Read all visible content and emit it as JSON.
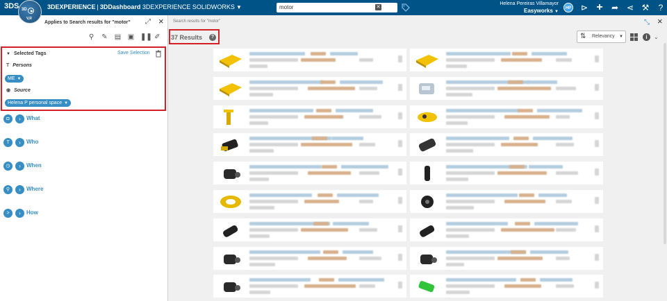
{
  "topbar": {
    "logo_text": "3DS",
    "compass_top": "3D",
    "compass_bottom": "V,R",
    "brand": "3DEXPERIENCE",
    "separator": "|",
    "app": "3DDashboard",
    "context": "3DEXPERIENCE SOLIDWORKS",
    "search_value": "motor",
    "user_name": "Helena Pereiras Villamayor",
    "user_role": "Easyworks",
    "avatar_initials": "HP"
  },
  "left_panel": {
    "title": "Applies to Search results for \"motor\"",
    "selected_tags_label": "Selected Tags",
    "save_selection_label": "Save Selection",
    "persons_label": "Persons",
    "persons_tag": "ME",
    "source_label": "Source",
    "source_tag": "Helena P personal space",
    "categories": [
      "What",
      "Who",
      "When",
      "Where",
      "How"
    ]
  },
  "right_panel": {
    "header": "Search results for \"motor\"",
    "results_count": "37 Results",
    "sort_label": "Relevancy"
  },
  "colors": {
    "topbar": "#005386",
    "accent": "#368ec4",
    "highlight_border": "#d32027"
  },
  "results": [
    {
      "thumb": "yellow-plate"
    },
    {
      "thumb": "yellow-plate"
    },
    {
      "thumb": "yellow-plate"
    },
    {
      "thumb": "grey-block"
    },
    {
      "thumb": "yellow-bracket"
    },
    {
      "thumb": "yellow-clip"
    },
    {
      "thumb": "black-yellow-motor"
    },
    {
      "thumb": "black-motor"
    },
    {
      "thumb": "black-part"
    },
    {
      "thumb": "black-pin"
    },
    {
      "thumb": "yellow-ring"
    },
    {
      "thumb": "black-gear"
    },
    {
      "thumb": "black-shaft"
    },
    {
      "thumb": "black-shaft"
    },
    {
      "thumb": "black-part"
    },
    {
      "thumb": "black-part"
    },
    {
      "thumb": "black-part"
    },
    {
      "thumb": "green-part"
    }
  ]
}
